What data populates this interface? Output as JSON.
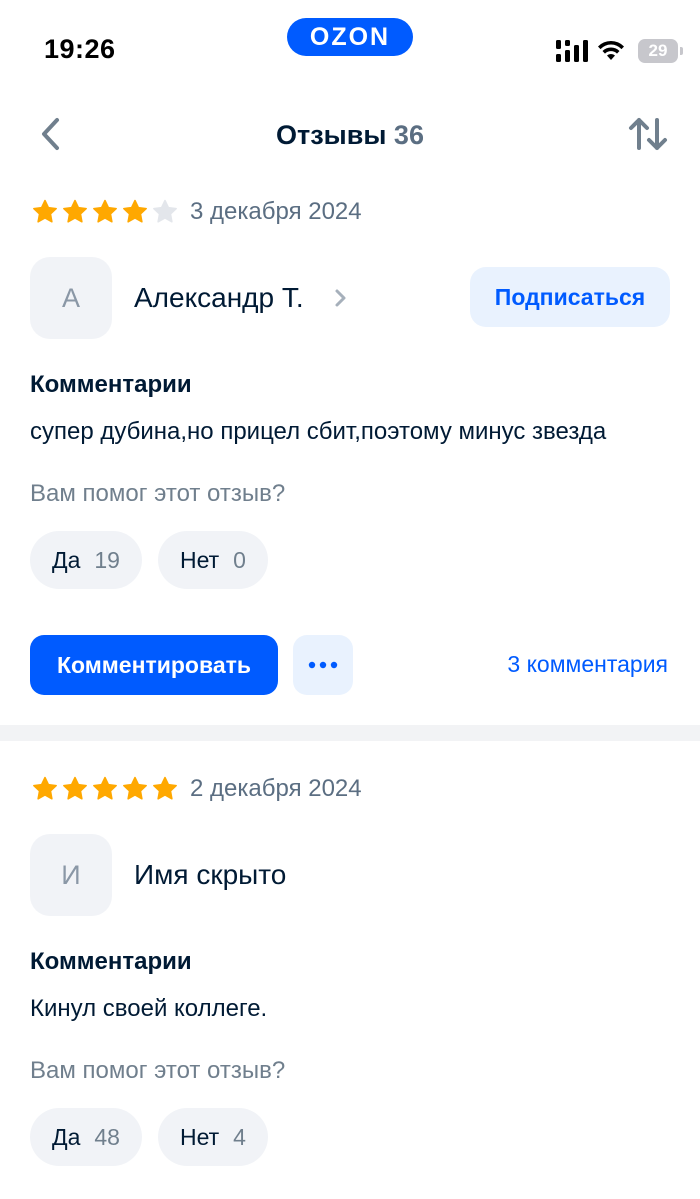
{
  "status_bar": {
    "time": "19:26",
    "brand": "OZON",
    "battery": "29"
  },
  "header": {
    "title": "Отзывы",
    "count": "36",
    "icons": {
      "back": "chevron-left-icon",
      "sort": "sort-arrows-icon"
    }
  },
  "colors": {
    "accent": "#005bff",
    "accent_light": "#e9f2fe",
    "star_filled": "#ffa800",
    "star_empty": "#e3e6eb",
    "text_primary": "#001a34",
    "text_secondary": "#707f8d"
  },
  "reviews": [
    {
      "rating": 4,
      "max_rating": 5,
      "date": "3 декабря 2024",
      "avatar_letter": "А",
      "author": "Александр Т.",
      "subscribe_label": "Подписаться",
      "section_label": "Комментарии",
      "comment": "супер дубина,но прицел сбит,поэтому минус звезда",
      "helpful_question": "Вам помог этот отзыв?",
      "yes_label": "Да",
      "yes_count": "19",
      "no_label": "Нет",
      "no_count": "0",
      "comment_button": "Комментировать",
      "comments_link": "3 комментария"
    },
    {
      "rating": 5,
      "max_rating": 5,
      "date": "2 декабря 2024",
      "avatar_letter": "И",
      "author": "Имя скрыто",
      "section_label": "Комментарии",
      "comment": "Кинул своей коллеге.",
      "helpful_question": "Вам помог этот отзыв?",
      "yes_label": "Да",
      "yes_count": "48",
      "no_label": "Нет",
      "no_count": "4"
    }
  ]
}
